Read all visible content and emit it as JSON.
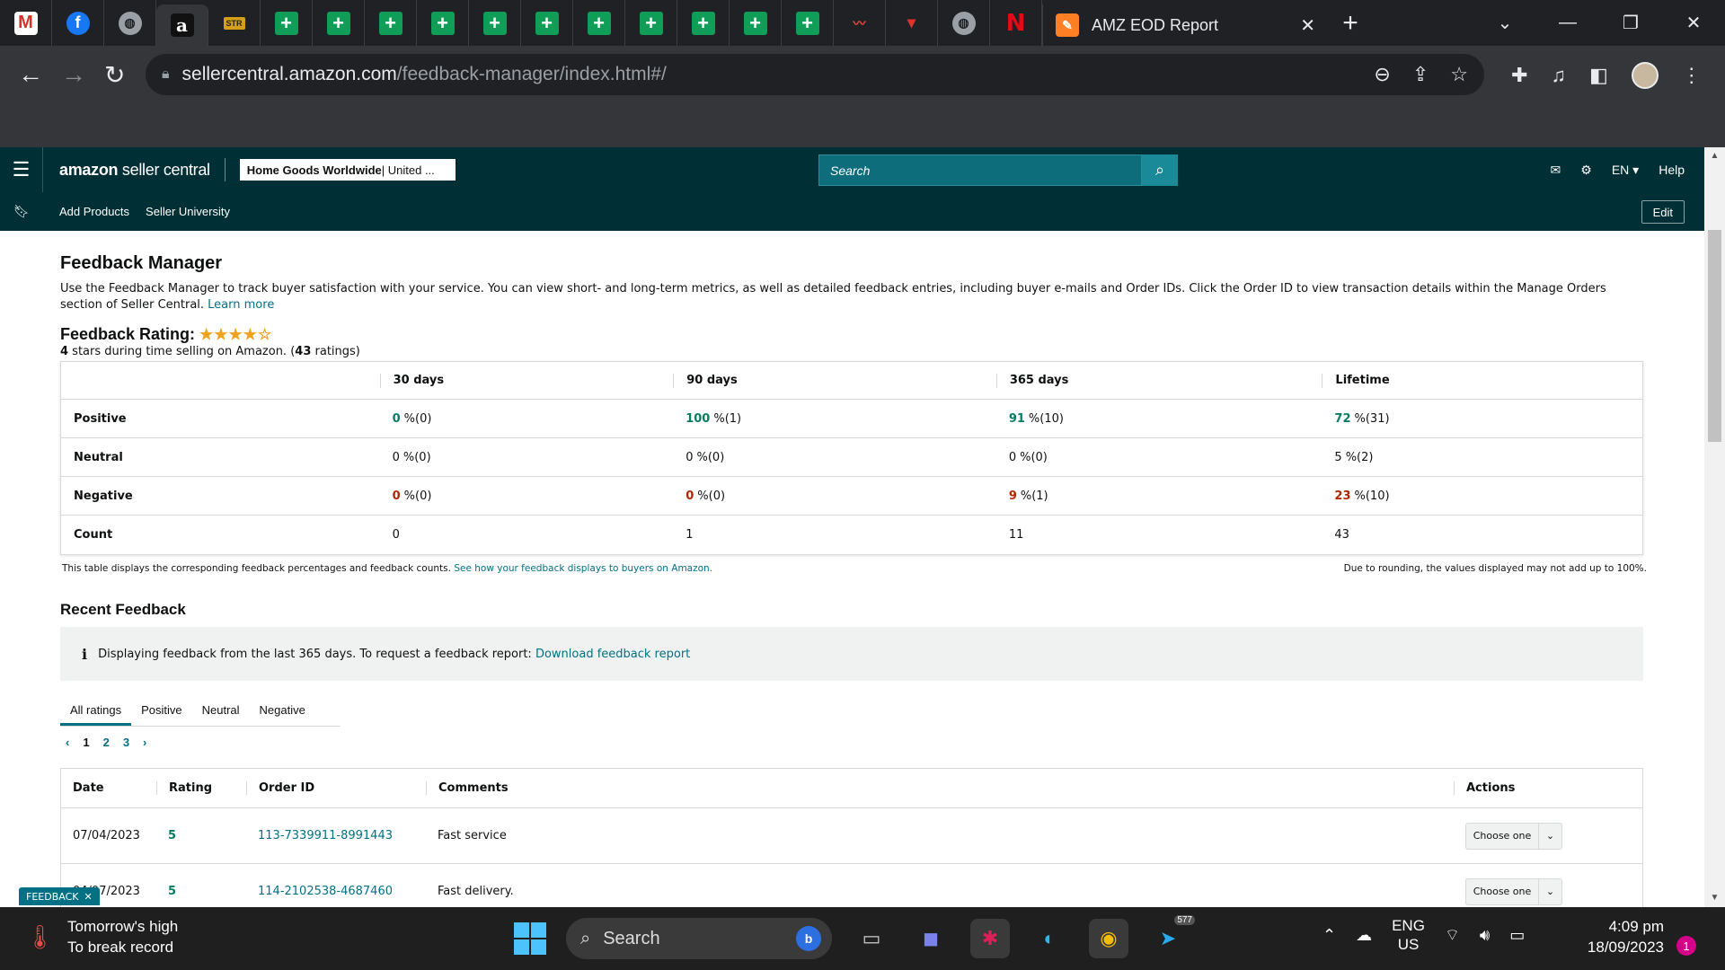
{
  "browser": {
    "pinned_tabs": [
      {
        "icon": "gmail-icon",
        "glyph": "M",
        "cls": "ic-gmail"
      },
      {
        "icon": "facebook-icon",
        "glyph": "f",
        "cls": "ic-fb"
      },
      {
        "icon": "globe-icon",
        "glyph": "◍",
        "cls": "ic-globe"
      },
      {
        "icon": "amazon-icon",
        "glyph": "a",
        "cls": "ic-amz",
        "active": true
      },
      {
        "icon": "stores-icon",
        "glyph": "STR",
        "cls": "ic-stores"
      },
      {
        "icon": "sheets-icon",
        "glyph": "+",
        "cls": "ic-sheet"
      },
      {
        "icon": "sheets-icon",
        "glyph": "+",
        "cls": "ic-sheet"
      },
      {
        "icon": "sheets-icon",
        "glyph": "+",
        "cls": "ic-sheet"
      },
      {
        "icon": "sheets-icon",
        "glyph": "+",
        "cls": "ic-sheet"
      },
      {
        "icon": "sheets-icon",
        "glyph": "+",
        "cls": "ic-sheet"
      },
      {
        "icon": "sheets-icon",
        "glyph": "+",
        "cls": "ic-sheet"
      },
      {
        "icon": "sheets-icon",
        "glyph": "+",
        "cls": "ic-sheet"
      },
      {
        "icon": "sheets-icon",
        "glyph": "+",
        "cls": "ic-sheet"
      },
      {
        "icon": "sheets-icon",
        "glyph": "+",
        "cls": "ic-sheet"
      },
      {
        "icon": "sheets-icon",
        "glyph": "+",
        "cls": "ic-sheet"
      },
      {
        "icon": "sheets-icon",
        "glyph": "+",
        "cls": "ic-sheet"
      },
      {
        "icon": "chart-icon",
        "glyph": "〰",
        "cls": "ic-chart"
      },
      {
        "icon": "red-logo-icon",
        "glyph": "▾",
        "cls": "ic-red"
      },
      {
        "icon": "globe-icon",
        "glyph": "◍",
        "cls": "ic-globe"
      },
      {
        "icon": "netflix-icon",
        "glyph": "N",
        "cls": "ic-netflix"
      }
    ],
    "active_tab_title": "AMZ EOD Report",
    "url_host": "sellercentral.amazon.com",
    "url_path": "/feedback-manager/index.html#/"
  },
  "header": {
    "logo_bold": "amazon",
    "logo_rest": " seller central",
    "store_name": "Home Goods Worldwide",
    "store_region": " | United ...",
    "search_placeholder": "Search",
    "language": "EN ▾",
    "help": "Help",
    "subnav": [
      "Add Products",
      "Seller University"
    ],
    "edit": "Edit"
  },
  "page": {
    "title": "Feedback Manager",
    "intro": "Use the Feedback Manager to track buyer satisfaction with your service. You can view short- and long-term metrics, as well as detailed feedback entries, including buyer e-mails and Order IDs. Click the Order ID to view transaction details within the Manage Orders section of Seller Central.",
    "learn_more": "Learn more",
    "rating_title": "Feedback Rating:",
    "stars": "★★★★☆",
    "rating_count_stars": "4",
    "rating_sub_mid": " stars during time selling on Amazon. (",
    "rating_count": "43",
    "rating_sub_end": " ratings)"
  },
  "feedback_table": {
    "columns": [
      "30 days",
      "90 days",
      "365 days",
      "Lifetime"
    ],
    "rows": [
      {
        "label": "Positive",
        "cells": [
          [
            "0",
            "%(0)",
            "pos"
          ],
          [
            "100",
            "%(1)",
            "pos"
          ],
          [
            "91",
            "%(10)",
            "pos"
          ],
          [
            "72",
            "%(31)",
            "pos"
          ]
        ]
      },
      {
        "label": "Neutral",
        "cells": [
          [
            "0",
            "%(0)",
            "plain"
          ],
          [
            "0",
            "%(0)",
            "plain"
          ],
          [
            "0",
            "%(0)",
            "plain"
          ],
          [
            "5",
            "%(2)",
            "plain"
          ]
        ]
      },
      {
        "label": "Negative",
        "cells": [
          [
            "0",
            "%(0)",
            "neg"
          ],
          [
            "0",
            "%(0)",
            "neg"
          ],
          [
            "9",
            "%(1)",
            "neg"
          ],
          [
            "23",
            "%(10)",
            "neg"
          ]
        ]
      },
      {
        "label": "Count",
        "cells": [
          [
            "0",
            "",
            "count"
          ],
          [
            "1",
            "",
            "count"
          ],
          [
            "11",
            "",
            "count"
          ],
          [
            "43",
            "",
            "count"
          ]
        ]
      }
    ],
    "note": "This table displays the corresponding feedback percentages and feedback counts.",
    "note_link": "See how your feedback displays to buyers on Amazon.",
    "note_right": "Due to rounding, the values displayed may not add up to 100%."
  },
  "recent": {
    "title": "Recent Feedback",
    "info_text": "Displaying feedback from the last 365 days. To request a feedback report:",
    "info_link": "Download feedback report",
    "tabs": [
      "All ratings",
      "Positive",
      "Neutral",
      "Negative"
    ],
    "pages": [
      "1",
      "2",
      "3"
    ],
    "columns": [
      "Date",
      "Rating",
      "Order ID",
      "Comments",
      "Actions"
    ],
    "rows": [
      {
        "date": "07/04/2023",
        "rating": "5",
        "order_id": "113-7339911-8991443",
        "comment": "Fast service",
        "action": "Choose one"
      },
      {
        "date": "04/07/2023",
        "rating": "5",
        "order_id": "114-2102538-4687460",
        "comment": "Fast delivery.",
        "action": "Choose one"
      }
    ]
  },
  "feedback_float": "FEEDBACK",
  "taskbar": {
    "weather_line1": "Tomorrow's high",
    "weather_line2": "To break record",
    "search": "Search",
    "telegram_badge": "577",
    "lang1": "ENG",
    "lang2": "US",
    "time": "4:09 pm",
    "date": "18/09/2023",
    "notifications": "1"
  },
  "colors": {
    "header_bg": "#002f36",
    "link": "#007185",
    "positive": "#067d62",
    "negative": "#b12704"
  }
}
